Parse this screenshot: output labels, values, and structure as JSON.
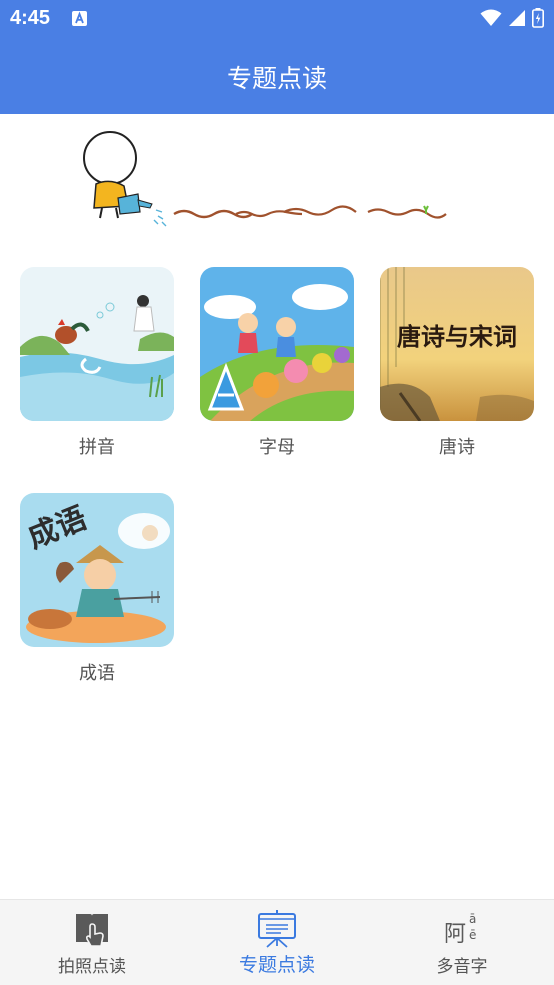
{
  "status_bar": {
    "time": "4:45",
    "notification_icon": "a-letter-icon",
    "icons": [
      "wifi-icon",
      "signal-icon",
      "battery-icon"
    ]
  },
  "app_bar": {
    "title": "专题点读",
    "color": "#4a7fe4"
  },
  "banner": {
    "illustration": "stick-figure-watering-can"
  },
  "topics": [
    {
      "label": "拼音",
      "image": "rooster-and-girl-by-stream"
    },
    {
      "label": "字母",
      "image": "children-on-alphabet-path"
    },
    {
      "label": "唐诗",
      "image": "willow-landscape",
      "image_text": "唐诗与宋词"
    },
    {
      "label": "成语",
      "image": "fisherman-boy-dreaming",
      "image_text": "成语"
    }
  ],
  "bottom_nav": {
    "items": [
      {
        "label": "拍照点读",
        "icon": "book-touch-icon",
        "active": false
      },
      {
        "label": "专题点读",
        "icon": "presentation-board-icon",
        "active": true
      },
      {
        "label": "多音字",
        "icon": "pinyin-character-icon",
        "active": false,
        "icon_text": "阿",
        "icon_pinyin_top": "ā",
        "icon_pinyin_bottom": "ē"
      }
    ],
    "active_color": "#3b7ae0"
  }
}
